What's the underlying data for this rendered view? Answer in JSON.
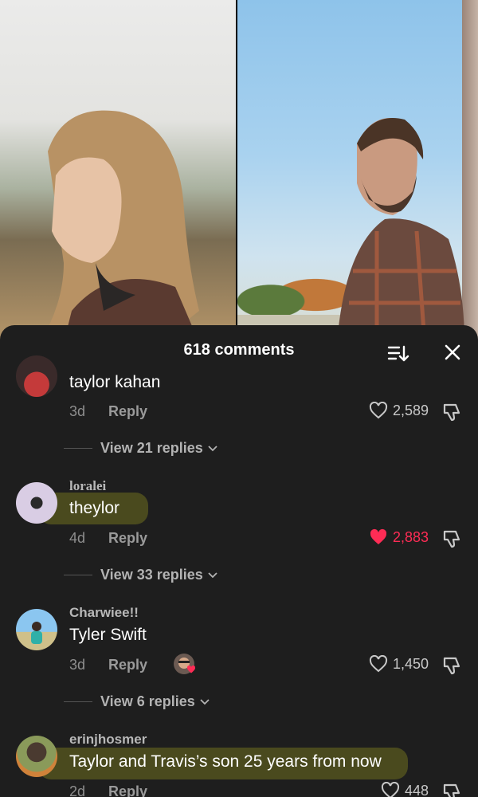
{
  "header": {
    "title": "618 comments"
  },
  "comments": [
    {
      "username": "",
      "text": "taylor kahan",
      "date": "3d",
      "reply_label": "Reply",
      "likes": "2,589",
      "liked": false,
      "view_replies": "View 21 replies"
    },
    {
      "username": "loralei",
      "text": "theylor",
      "date": "4d",
      "reply_label": "Reply",
      "likes": "2,883",
      "liked": true,
      "view_replies": "View 33 replies"
    },
    {
      "username": "Charwiee!!",
      "text": "Tyler Swift",
      "date": "3d",
      "reply_label": "Reply",
      "likes": "1,450",
      "liked": false,
      "creator_liked": true,
      "view_replies": "View 6 replies"
    },
    {
      "username": "erinjhosmer",
      "text": "Taylor and Travis’s son 25 years from now",
      "date": "2d",
      "reply_label": "Reply",
      "likes": "448",
      "liked": false
    }
  ],
  "colors": {
    "sheet_bg": "#1e1e1e",
    "liked": "#fe2c55",
    "highlight": "#4a4a1e"
  },
  "icons": [
    "sort-icon",
    "close-icon",
    "heart-icon",
    "dislike-icon",
    "chevron-down-icon"
  ]
}
